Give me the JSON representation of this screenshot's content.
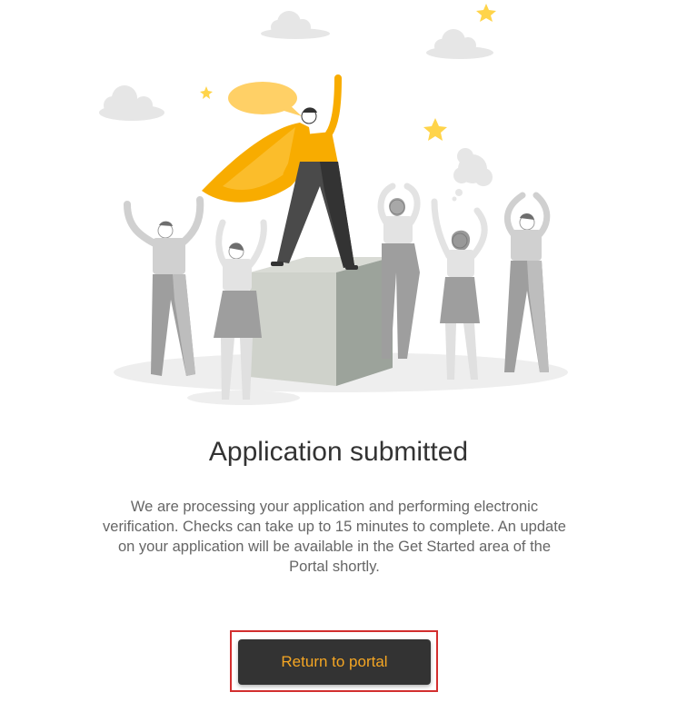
{
  "illustration": {
    "description_icons": [
      "cloud-icon",
      "star-icon",
      "speech-bubble-icon",
      "thought-bubble-icon",
      "pedestal",
      "hero-figure",
      "cheering-crowd"
    ],
    "colors": {
      "accent": "#f8ac00",
      "accent_light": "#ffd066",
      "figure_gray": "#9e9e9e",
      "cloud_gray": "#e6e6e6"
    }
  },
  "main": {
    "title": "Application submitted",
    "description": "We are processing your application and performing electronic verification. Checks can take up to 15 minutes to complete. An update on your application will be available in the Get Started area of the Portal shortly.",
    "return_button_label": "Return to portal"
  },
  "colors": {
    "button_bg": "#333333",
    "button_text": "#f5a623",
    "highlight_border": "#d32f2f"
  }
}
